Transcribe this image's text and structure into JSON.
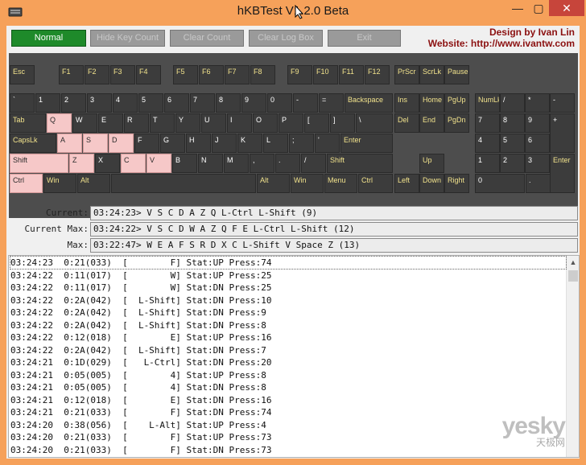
{
  "window": {
    "title": "hKBTest V1.2.0 Beta"
  },
  "titlebar": {
    "minimize": "—",
    "maximize": "▢",
    "close": "✕"
  },
  "toolbar": {
    "normal": "Normal",
    "hide_key_count": "Hide Key Count",
    "clear_count": "Clear Count",
    "clear_log_box": "Clear Log Box",
    "exit": "Exit"
  },
  "credit": {
    "line1": "Design by Ivan Lin",
    "line2": "Website: http://www.ivantw.com"
  },
  "keyboard": {
    "keys": [
      {
        "id": "esc",
        "label": "Esc"
      },
      {
        "id": "f1",
        "label": "F1"
      },
      {
        "id": "f2",
        "label": "F2"
      },
      {
        "id": "f3",
        "label": "F3"
      },
      {
        "id": "f4",
        "label": "F4"
      },
      {
        "id": "f5",
        "label": "F5"
      },
      {
        "id": "f6",
        "label": "F6"
      },
      {
        "id": "f7",
        "label": "F7"
      },
      {
        "id": "f8",
        "label": "F8"
      },
      {
        "id": "f9",
        "label": "F9"
      },
      {
        "id": "f10",
        "label": "F10"
      },
      {
        "id": "f11",
        "label": "F11"
      },
      {
        "id": "f12",
        "label": "F12"
      },
      {
        "id": "prscr",
        "label": "PrScr"
      },
      {
        "id": "scrlk",
        "label": "ScrLk"
      },
      {
        "id": "pause",
        "label": "Pause"
      },
      {
        "id": "backtick",
        "label": "`"
      },
      {
        "id": "1",
        "label": "1"
      },
      {
        "id": "2",
        "label": "2"
      },
      {
        "id": "3",
        "label": "3"
      },
      {
        "id": "4",
        "label": "4"
      },
      {
        "id": "5",
        "label": "5"
      },
      {
        "id": "6",
        "label": "6"
      },
      {
        "id": "7",
        "label": "7"
      },
      {
        "id": "8",
        "label": "8"
      },
      {
        "id": "9",
        "label": "9"
      },
      {
        "id": "0",
        "label": "0"
      },
      {
        "id": "minus",
        "label": "-"
      },
      {
        "id": "equals",
        "label": "="
      },
      {
        "id": "backspace",
        "label": "Backspace"
      },
      {
        "id": "ins",
        "label": "Ins"
      },
      {
        "id": "home",
        "label": "Home"
      },
      {
        "id": "pgup",
        "label": "PgUp"
      },
      {
        "id": "numlk",
        "label": "NumLk"
      },
      {
        "id": "np-div",
        "label": "/"
      },
      {
        "id": "np-mul",
        "label": "*"
      },
      {
        "id": "np-sub",
        "label": "-"
      },
      {
        "id": "tab",
        "label": "Tab"
      },
      {
        "id": "q",
        "label": "Q"
      },
      {
        "id": "w",
        "label": "W"
      },
      {
        "id": "e",
        "label": "E"
      },
      {
        "id": "r",
        "label": "R"
      },
      {
        "id": "t",
        "label": "T"
      },
      {
        "id": "y",
        "label": "Y"
      },
      {
        "id": "u",
        "label": "U"
      },
      {
        "id": "i",
        "label": "I"
      },
      {
        "id": "o",
        "label": "O"
      },
      {
        "id": "p",
        "label": "P"
      },
      {
        "id": "lbracket",
        "label": "["
      },
      {
        "id": "rbracket",
        "label": "]"
      },
      {
        "id": "backslash",
        "label": "\\"
      },
      {
        "id": "del",
        "label": "Del"
      },
      {
        "id": "end",
        "label": "End"
      },
      {
        "id": "pgdn",
        "label": "PgDn"
      },
      {
        "id": "np7",
        "label": "7"
      },
      {
        "id": "np8",
        "label": "8"
      },
      {
        "id": "np9",
        "label": "9"
      },
      {
        "id": "np-add",
        "label": "+"
      },
      {
        "id": "capslk",
        "label": "CapsLk"
      },
      {
        "id": "a",
        "label": "A"
      },
      {
        "id": "s",
        "label": "S"
      },
      {
        "id": "d",
        "label": "D"
      },
      {
        "id": "f",
        "label": "F"
      },
      {
        "id": "g",
        "label": "G"
      },
      {
        "id": "h",
        "label": "H"
      },
      {
        "id": "j",
        "label": "J"
      },
      {
        "id": "k",
        "label": "K"
      },
      {
        "id": "l",
        "label": "L"
      },
      {
        "id": "semicolon",
        "label": ";"
      },
      {
        "id": "quote",
        "label": "'"
      },
      {
        "id": "enter",
        "label": "Enter"
      },
      {
        "id": "np4",
        "label": "4"
      },
      {
        "id": "np5",
        "label": "5"
      },
      {
        "id": "np6",
        "label": "6"
      },
      {
        "id": "lshift",
        "label": "Shift"
      },
      {
        "id": "z",
        "label": "Z"
      },
      {
        "id": "x",
        "label": "X"
      },
      {
        "id": "c",
        "label": "C"
      },
      {
        "id": "v",
        "label": "V"
      },
      {
        "id": "b",
        "label": "B"
      },
      {
        "id": "n",
        "label": "N"
      },
      {
        "id": "m",
        "label": "M"
      },
      {
        "id": "comma",
        "label": ","
      },
      {
        "id": "period",
        "label": "."
      },
      {
        "id": "slash",
        "label": "/"
      },
      {
        "id": "rshift",
        "label": "Shift"
      },
      {
        "id": "up",
        "label": "Up"
      },
      {
        "id": "np1",
        "label": "1"
      },
      {
        "id": "np2",
        "label": "2"
      },
      {
        "id": "np3",
        "label": "3"
      },
      {
        "id": "np-enter",
        "label": "Enter"
      },
      {
        "id": "lctrl",
        "label": "Ctrl"
      },
      {
        "id": "lwin",
        "label": "Win"
      },
      {
        "id": "lalt",
        "label": "Alt"
      },
      {
        "id": "space",
        "label": ""
      },
      {
        "id": "ralt",
        "label": "Alt"
      },
      {
        "id": "rwin",
        "label": "Win"
      },
      {
        "id": "menu",
        "label": "Menu"
      },
      {
        "id": "rctrl",
        "label": "Ctrl"
      },
      {
        "id": "left",
        "label": "Left"
      },
      {
        "id": "down",
        "label": "Down"
      },
      {
        "id": "right",
        "label": "Right"
      },
      {
        "id": "np0",
        "label": "0"
      },
      {
        "id": "np-dot",
        "label": "."
      }
    ]
  },
  "stats": {
    "current_label": "Current:",
    "current_value": "03:24:23> V S C D A Z Q L-Ctrl L-Shift (9)",
    "current_max_label": "Current Max:",
    "current_max_value": "03:24:22> V S C D W A Z Q F E L-Ctrl L-Shift (12)",
    "max_label": "Max:",
    "max_value": "03:22:47> W E A F S R D X C L-Shift V Space Z (13)"
  },
  "log": {
    "lines": [
      "03:24:23  0:21(033)  [        F] Stat:UP Press:74",
      "03:24:22  0:11(017)  [        W] Stat:UP Press:25",
      "03:24:22  0:11(017)  [        W] Stat:DN Press:25",
      "03:24:22  0:2A(042)  [  L-Shift] Stat:DN Press:10",
      "03:24:22  0:2A(042)  [  L-Shift] Stat:DN Press:9",
      "03:24:22  0:2A(042)  [  L-Shift] Stat:DN Press:8",
      "03:24:22  0:12(018)  [        E] Stat:UP Press:16",
      "03:24:22  0:2A(042)  [  L-Shift] Stat:DN Press:7",
      "03:24:21  0:1D(029)  [   L-Ctrl] Stat:DN Press:20",
      "03:24:21  0:05(005)  [        4] Stat:UP Press:8",
      "03:24:21  0:05(005)  [        4] Stat:DN Press:8",
      "03:24:21  0:12(018)  [        E] Stat:DN Press:16",
      "03:24:21  0:21(033)  [        F] Stat:DN Press:74",
      "03:24:20  0:38(056)  [    L-Alt] Stat:UP Press:4",
      "03:24:20  0:21(033)  [        F] Stat:UP Press:73",
      "03:24:20  0:21(033)  [        F] Stat:DN Press:73"
    ]
  },
  "watermark": {
    "main": "yesky",
    "sub": "天极网"
  }
}
